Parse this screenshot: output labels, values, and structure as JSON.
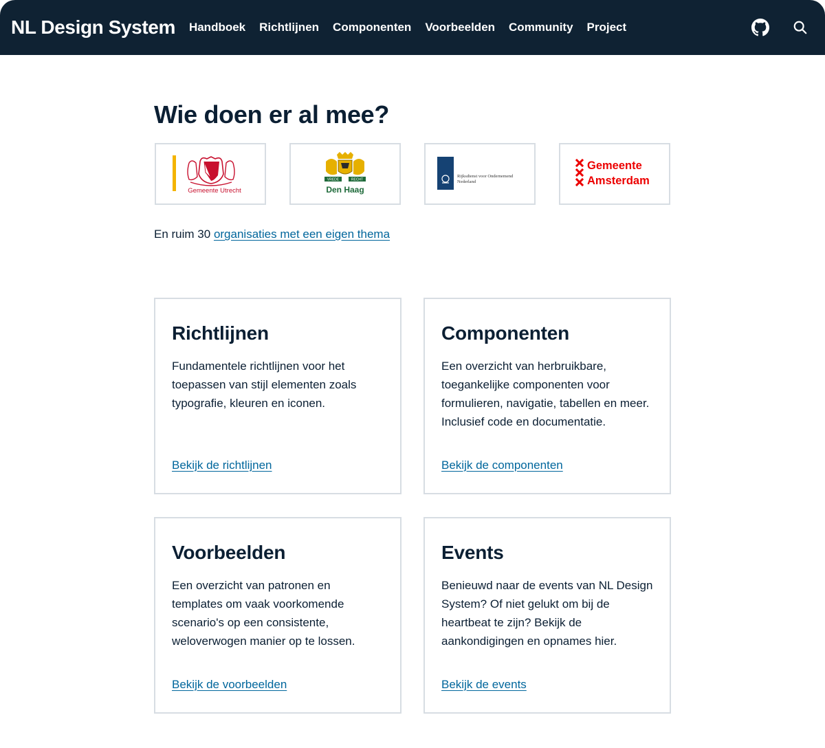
{
  "header": {
    "brand": "NL Design System",
    "nav": [
      {
        "label": "Handboek"
      },
      {
        "label": "Richtlijnen"
      },
      {
        "label": "Componenten"
      },
      {
        "label": "Voorbeelden"
      },
      {
        "label": "Community"
      },
      {
        "label": "Project"
      }
    ],
    "icons": [
      "github-icon",
      "search-icon"
    ]
  },
  "participants": {
    "title": "Wie doen er al mee?",
    "logos": [
      {
        "name": "Gemeente Utrecht",
        "text": "Gemeente Utrecht",
        "color": "#c8102e",
        "accent": "#f4b400"
      },
      {
        "name": "Den Haag",
        "text": "Den Haag",
        "banner_left": "VREDE",
        "banner_right": "RECHT",
        "color": "#1e6a3a",
        "accent": "#e6b000"
      },
      {
        "name": "Rijksdienst voor Ondernemend Nederland",
        "text_line1": "Rijksdienst voor Ondernemend",
        "text_line2": "Nederland",
        "color": "#154273"
      },
      {
        "name": "Gemeente Amsterdam",
        "text_line1": "Gemeente",
        "text_line2": "Amsterdam",
        "color": "#ec0000"
      }
    ],
    "more_prefix": "En ruim 30",
    "more_link": "organisaties met een eigen thema"
  },
  "cards": [
    {
      "title": "Richtlijnen",
      "body": "Fundamentele richtlijnen voor het toepassen van stijl elementen zoals typografie, kleuren en iconen.",
      "link": "Bekijk de richtlijnen"
    },
    {
      "title": "Componenten",
      "body": "Een overzicht van herbruikbare, toegankelijke componenten voor formulieren, navigatie, tabellen en meer. Inclusief code en documentatie.",
      "link": "Bekijk de componenten"
    },
    {
      "title": "Voorbeelden",
      "body": "Een overzicht van patronen en templates om vaak voorkomende scenario's op een consistente, weloverwogen manier op te lossen.",
      "link": "Bekijk de voorbeelden"
    },
    {
      "title": "Events",
      "body": "Benieuwd naar de events van NL Design System? Of niet gelukt om bij de heartbeat te zijn? Bekijk de aankondigingen en opnames hier.",
      "link": "Bekijk de events"
    }
  ],
  "colors": {
    "header_bg": "#0f2233",
    "text": "#0b1f33",
    "link": "#00669c",
    "border": "#d7dde3"
  }
}
